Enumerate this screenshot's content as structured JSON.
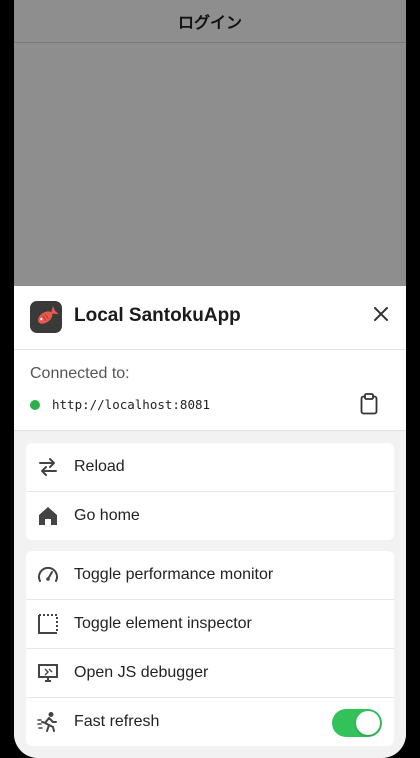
{
  "screen_title": "ログイン",
  "app": {
    "name": "Local SantokuApp",
    "icon": "fish-icon"
  },
  "connection": {
    "label": "Connected to:",
    "url": "http://localhost:8081",
    "status_color": "#2ab04a"
  },
  "group1": [
    {
      "label": "Reload",
      "icon": "reload-icon"
    },
    {
      "label": "Go home",
      "icon": "home-icon"
    }
  ],
  "group2": [
    {
      "label": "Toggle performance monitor",
      "icon": "gauge-icon"
    },
    {
      "label": "Toggle element inspector",
      "icon": "inspector-icon"
    },
    {
      "label": "Open JS debugger",
      "icon": "debugger-icon"
    },
    {
      "label": "Fast refresh",
      "icon": "running-icon",
      "toggle_on": true
    }
  ],
  "accent_color": "#33c25a"
}
